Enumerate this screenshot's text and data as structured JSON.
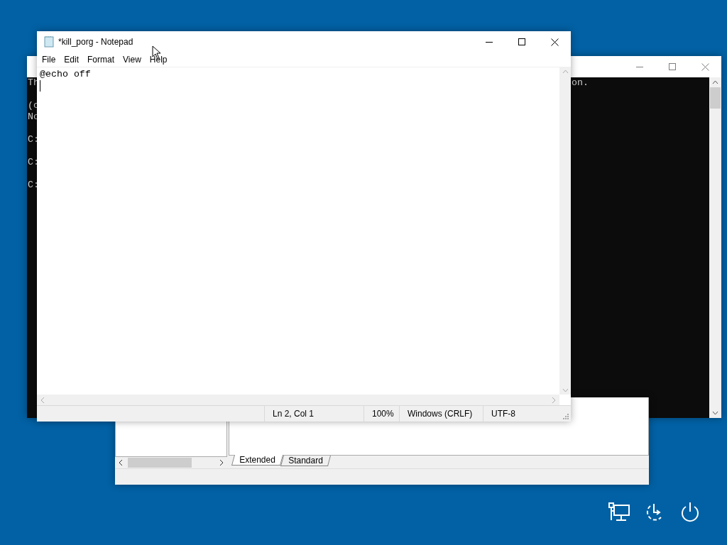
{
  "console_window": {
    "lines": [
      {
        "kind": "text",
        "text": "Th"
      },
      {
        "kind": "blank"
      },
      {
        "kind": "text",
        "text": "(c"
      },
      {
        "kind": "text",
        "text": "No"
      },
      {
        "kind": "blank"
      },
      {
        "kind": "text",
        "text": "C:"
      },
      {
        "kind": "blank"
      },
      {
        "kind": "text",
        "text": "C:"
      },
      {
        "kind": "blank"
      },
      {
        "kind": "text",
        "text": "C:"
      }
    ],
    "right_text": "on."
  },
  "notepad": {
    "title": "*kill_porg - Notepad",
    "menu": [
      "File",
      "Edit",
      "Format",
      "View",
      "Help"
    ],
    "content": "@echo off",
    "status": [
      "Ln 2, Col 1",
      "100%",
      "Windows (CRLF)",
      "UTF-8"
    ]
  },
  "back_window": {
    "tabs": [
      {
        "label": "Extended",
        "selected": true
      },
      {
        "label": "Standard",
        "selected": false
      }
    ]
  }
}
